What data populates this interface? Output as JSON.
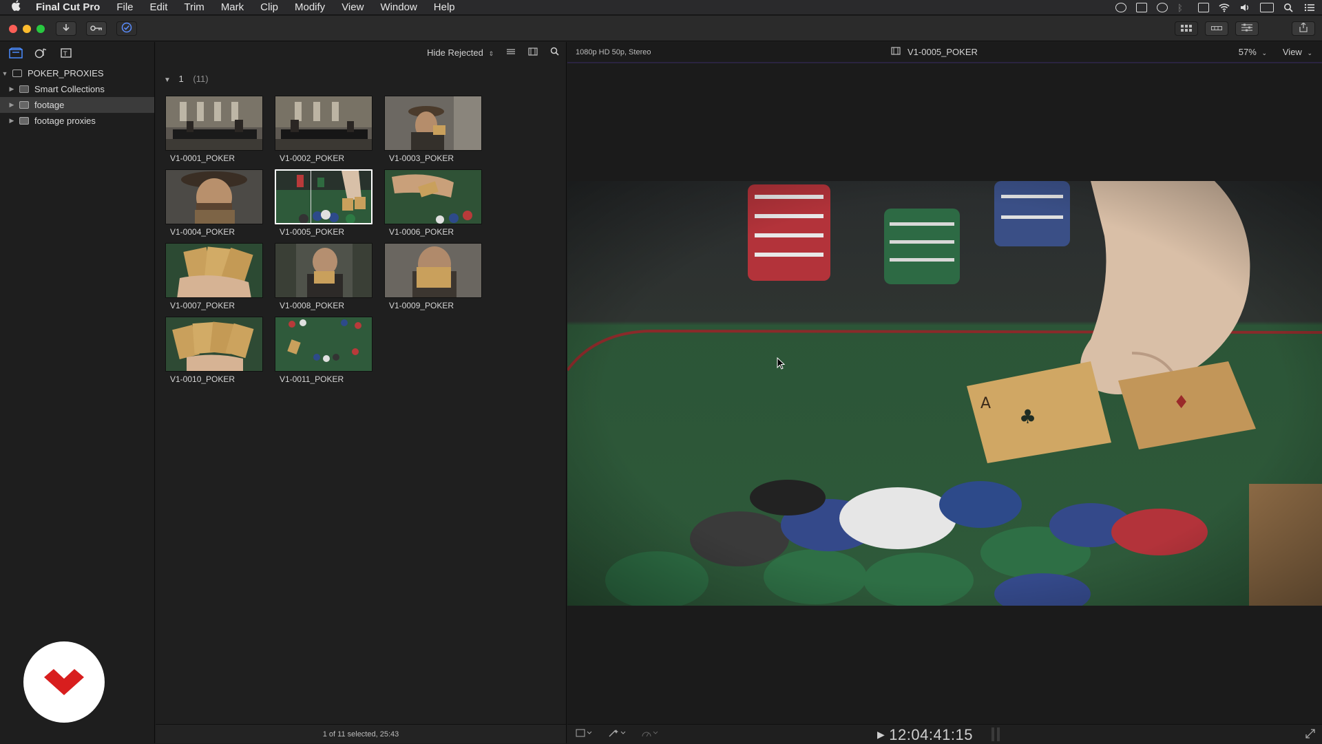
{
  "menubar": {
    "apple": "",
    "items": [
      "Final Cut Pro",
      "File",
      "Edit",
      "Trim",
      "Mark",
      "Clip",
      "Modify",
      "View",
      "Window",
      "Help"
    ]
  },
  "sidebar": {
    "library": "POKER_PROXIES",
    "items": [
      {
        "label": "Smart Collections"
      },
      {
        "label": "footage"
      },
      {
        "label": "footage proxies"
      }
    ]
  },
  "browser": {
    "filter": "Hide Rejected",
    "group": {
      "name": "1",
      "count": "(11)"
    },
    "clips": [
      {
        "name": "V1-0001_POKER"
      },
      {
        "name": "V1-0002_POKER"
      },
      {
        "name": "V1-0003_POKER"
      },
      {
        "name": "V1-0004_POKER"
      },
      {
        "name": "V1-0005_POKER"
      },
      {
        "name": "V1-0006_POKER"
      },
      {
        "name": "V1-0007_POKER"
      },
      {
        "name": "V1-0008_POKER"
      },
      {
        "name": "V1-0009_POKER"
      },
      {
        "name": "V1-0010_POKER"
      },
      {
        "name": "V1-0011_POKER"
      }
    ],
    "footer": "1 of 11 selected, 25:43"
  },
  "viewer": {
    "format": "1080p HD 50p, Stereo",
    "clip_title": "V1-0005_POKER",
    "zoom": "57%",
    "view_menu": "View",
    "timecode": "12:04:41:15"
  },
  "colors": {
    "accent": "#4a8cff",
    "table_felt": "#2f5a3a",
    "logo_red": "#d81e1e"
  }
}
